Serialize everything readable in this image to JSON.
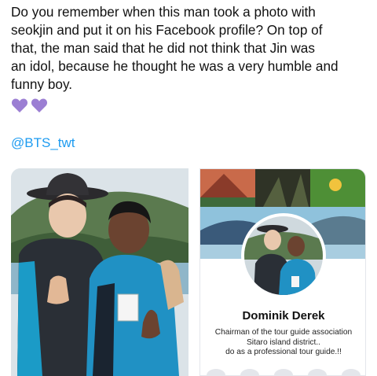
{
  "tweet": {
    "lines": [
      "Do you remember when this man took a photo with",
      "seokjin and put it on his Facebook profile? On top of",
      "that, the man said that he did not think that Jin was",
      "an idol, because he thought he was a very humble and",
      "funny boy."
    ],
    "heart_color": "#9b7ed3",
    "mention": "@BTS_twt",
    "mention_color": "#1d9bf0"
  },
  "facebook_profile": {
    "name": "Dominik Derek",
    "bio_lines": [
      "Chairman of the  tour guide association",
      "Sitaro island district..",
      "do as a professional tour guide.!!"
    ]
  }
}
